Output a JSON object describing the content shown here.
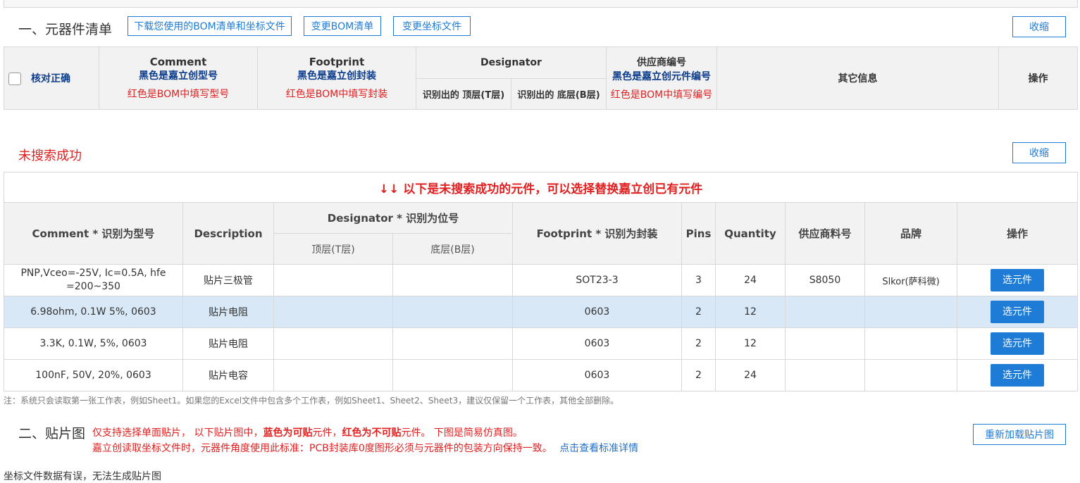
{
  "section1": {
    "title": "一、元器件清单",
    "btn_download": "下载您使用的BOM清单和坐标文件",
    "btn_change_bom": "变更BOM清单",
    "btn_change_coord": "变更坐标文件",
    "btn_collapse": "收缩"
  },
  "bom_header": {
    "check_label": "核对正确",
    "comment": "Comment",
    "comment_black": "黑色是嘉立创型号",
    "comment_red": "红色是BOM中填写型号",
    "footprint": "Footprint",
    "footprint_black": "黑色是嘉立创封装",
    "footprint_red": "红色是BOM中填写封装",
    "designator": "Designator",
    "designator_top": "识别出的 顶层(T层)",
    "designator_bottom": "识别出的 底层(B层)",
    "supplier": "供应商编号",
    "supplier_black": "黑色是嘉立创元件编号",
    "supplier_red": "红色是BOM中填写编号",
    "other": "其它信息",
    "action": "操作"
  },
  "not_found": {
    "title": "未搜索成功",
    "btn_collapse": "收缩",
    "banner": "↓↓  以下是未搜索成功的元件，可以选择替换嘉立创已有元件",
    "headers": {
      "comment": "Comment * 识别为型号",
      "description": "Description",
      "designator": "Designator * 识别为位号",
      "top": "顶层(T层)",
      "bottom": "底层(B层)",
      "footprint": "Footprint * 识别为封装",
      "pins": "Pins",
      "quantity": "Quantity",
      "supplier_part": "供应商料号",
      "brand": "品牌",
      "action": "操作"
    },
    "rows": [
      {
        "comment": "PNP,Vceo=-25V, Ic=0.5A, hfe =200~350",
        "description": "贴片三极管",
        "top": "",
        "bottom": "",
        "footprint": "SOT23-3",
        "pins": "3",
        "quantity": "24",
        "supplier_part": "S8050",
        "brand": "Slkor(萨科微)",
        "action": "选元件"
      },
      {
        "comment": "6.98ohm, 0.1W 5%, 0603",
        "description": "贴片电阻",
        "top": "",
        "bottom": "",
        "footprint": "0603",
        "pins": "2",
        "quantity": "12",
        "supplier_part": "",
        "brand": "",
        "action": "选元件"
      },
      {
        "comment": "3.3K, 0.1W, 5%, 0603",
        "description": "贴片电阻",
        "top": "",
        "bottom": "",
        "footprint": "0603",
        "pins": "2",
        "quantity": "12",
        "supplier_part": "",
        "brand": "",
        "action": "选元件"
      },
      {
        "comment": "100nF, 50V, 20%, 0603",
        "description": "贴片电容",
        "top": "",
        "bottom": "",
        "footprint": "0603",
        "pins": "2",
        "quantity": "24",
        "supplier_part": "",
        "brand": "",
        "action": "选元件"
      }
    ],
    "note": "注：系统只会读取第一张工作表，例如Sheet1。如果您的Excel文件中包含多个工作表，例如Sheet1、Sheet2、Sheet3，建议仅保留一个工作表，其他全部删除。"
  },
  "section2": {
    "title": "二、贴片图",
    "line1_a": "仅支持选择单面贴片， 以下贴片图中，",
    "line1_b": "蓝色为可贴",
    "line1_c": "元件，",
    "line1_d": "红色为不可贴",
    "line1_e": "元件。 下图是简易仿真图。",
    "line2": "嘉立创读取坐标文件时，元器件角度使用此标准：PCB封装库0度图形必须与元器件的包装方向保持一致。",
    "line2_link": "点击查看标准详情",
    "btn_reload": "重新加载贴片图",
    "footer": "坐标文件数据有误，无法生成贴片图"
  },
  "colors": {
    "accent": "#1e7bd6",
    "error": "#e02020",
    "header_blue": "#0b3c8c",
    "selected_row": "#d9e8f6"
  }
}
